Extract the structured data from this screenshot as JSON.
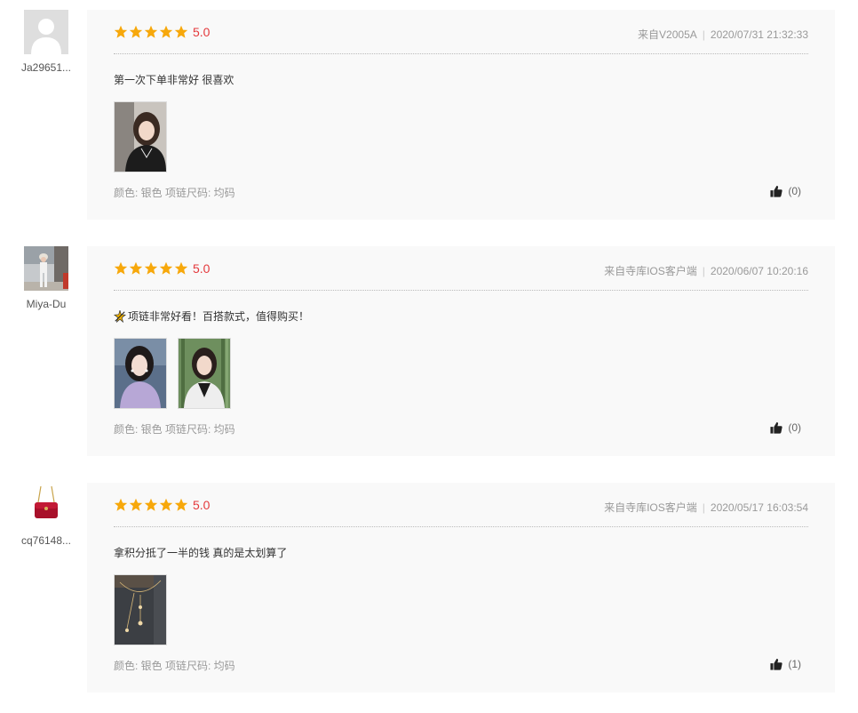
{
  "colors": {
    "star": "#f7a80b",
    "score": "#e4393c",
    "card_bg": "#f9f9f9"
  },
  "icons": {
    "star": "star-icon",
    "like": "thumbs-up-icon",
    "emoji": "sparkle-emoji-icon"
  },
  "reviews": [
    {
      "username": "Ja29651...",
      "avatar": "default-avatar",
      "rating": 5,
      "score": "5.0",
      "source": "来自V2005A",
      "datetime": "2020/07/31 21:32:33",
      "text": "第一次下单非常好 很喜欢",
      "has_emoji": false,
      "photos": [
        "photo-woman-car-selfie"
      ],
      "attributes": "颜色: 银色 项链尺码: 均码",
      "likes": "(0)"
    },
    {
      "username": "Miya-Du",
      "avatar": "photo-avatar-street",
      "rating": 5,
      "score": "5.0",
      "source": "来自寺库IOS客户端",
      "datetime": "2020/06/07 10:20:16",
      "text": "项链非常好看！百搭款式，值得购买！",
      "has_emoji": true,
      "photos": [
        "photo-woman-purple-top",
        "photo-woman-bamboo"
      ],
      "attributes": "颜色: 银色 项链尺码: 均码",
      "likes": "(0)"
    },
    {
      "username": "cq76148...",
      "avatar": "photo-avatar-red-bag",
      "rating": 5,
      "score": "5.0",
      "source": "来自寺库IOS客户端",
      "datetime": "2020/05/17 16:03:54",
      "text": "拿积分抵了一半的钱 真的是太划算了",
      "has_emoji": false,
      "photos": [
        "photo-necklace-dark"
      ],
      "attributes": "颜色: 银色 项链尺码: 均码",
      "likes": "(1)"
    }
  ]
}
